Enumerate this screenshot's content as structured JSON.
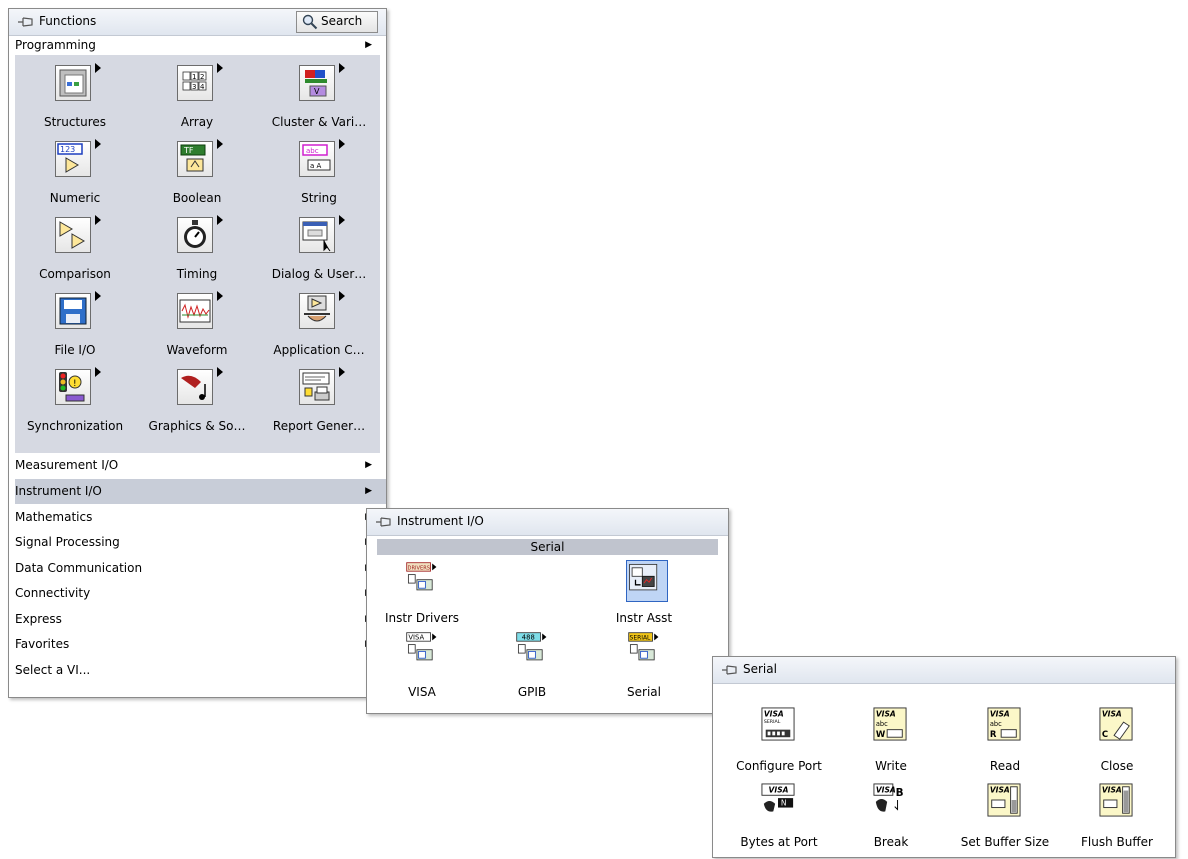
{
  "functions": {
    "title": "Functions",
    "search_label": "Search",
    "header_item": "Programming",
    "grid": [
      {
        "label": "Structures",
        "icon": "structures-icon"
      },
      {
        "label": "Array",
        "icon": "array-icon"
      },
      {
        "label": "Cluster & Vari…",
        "icon": "cluster-icon"
      },
      {
        "label": "Numeric",
        "icon": "numeric-icon"
      },
      {
        "label": "Boolean",
        "icon": "boolean-icon"
      },
      {
        "label": "String",
        "icon": "string-icon"
      },
      {
        "label": "Comparison",
        "icon": "comparison-icon"
      },
      {
        "label": "Timing",
        "icon": "timing-icon"
      },
      {
        "label": "Dialog & User…",
        "icon": "dialog-icon"
      },
      {
        "label": "File I/O",
        "icon": "file-io-icon"
      },
      {
        "label": "Waveform",
        "icon": "waveform-icon"
      },
      {
        "label": "Application C…",
        "icon": "application-control-icon"
      },
      {
        "label": "Synchronization",
        "icon": "synchronization-icon"
      },
      {
        "label": "Graphics & So…",
        "icon": "graphics-sound-icon"
      },
      {
        "label": "Report Gener…",
        "icon": "report-generation-icon"
      }
    ],
    "menu": [
      {
        "label": "Measurement I/O",
        "submenu": true
      },
      {
        "label": "Instrument I/O",
        "submenu": true,
        "selected": true
      },
      {
        "label": "Mathematics",
        "submenu": true
      },
      {
        "label": "Signal Processing",
        "submenu": true
      },
      {
        "label": "Data Communication",
        "submenu": true
      },
      {
        "label": "Connectivity",
        "submenu": true
      },
      {
        "label": "Express",
        "submenu": true
      },
      {
        "label": "Favorites",
        "submenu": true
      },
      {
        "label": "Select a VI...",
        "submenu": false
      }
    ]
  },
  "instrument_io": {
    "title": "Instrument I/O",
    "section": "Serial",
    "items": [
      {
        "label": "Instr Drivers",
        "tag": "DRIVERS"
      },
      {
        "label": "Instr Asst",
        "tag": ""
      },
      {
        "label": "VISA",
        "tag": "VISA"
      },
      {
        "label": "GPIB",
        "tag": "488"
      },
      {
        "label": "Serial",
        "tag": "SERIAL"
      }
    ]
  },
  "serial": {
    "title": "Serial",
    "items": [
      {
        "label": "Configure Port",
        "tag": "VISA"
      },
      {
        "label": "Write",
        "tag": "VISA"
      },
      {
        "label": "Read",
        "tag": "VISA"
      },
      {
        "label": "Close",
        "tag": "VISA"
      },
      {
        "label": "Bytes at Port",
        "tag": "VISA"
      },
      {
        "label": "Break",
        "tag": "VISA"
      },
      {
        "label": "Set Buffer Size",
        "tag": "VISA"
      },
      {
        "label": "Flush Buffer",
        "tag": "VISA"
      }
    ]
  },
  "colors": {
    "selection": "#c8cdd8",
    "grid_bg": "#d6d9e2",
    "icon_yellow": "#fbf7c8",
    "highlight": "#bfd5f5"
  }
}
